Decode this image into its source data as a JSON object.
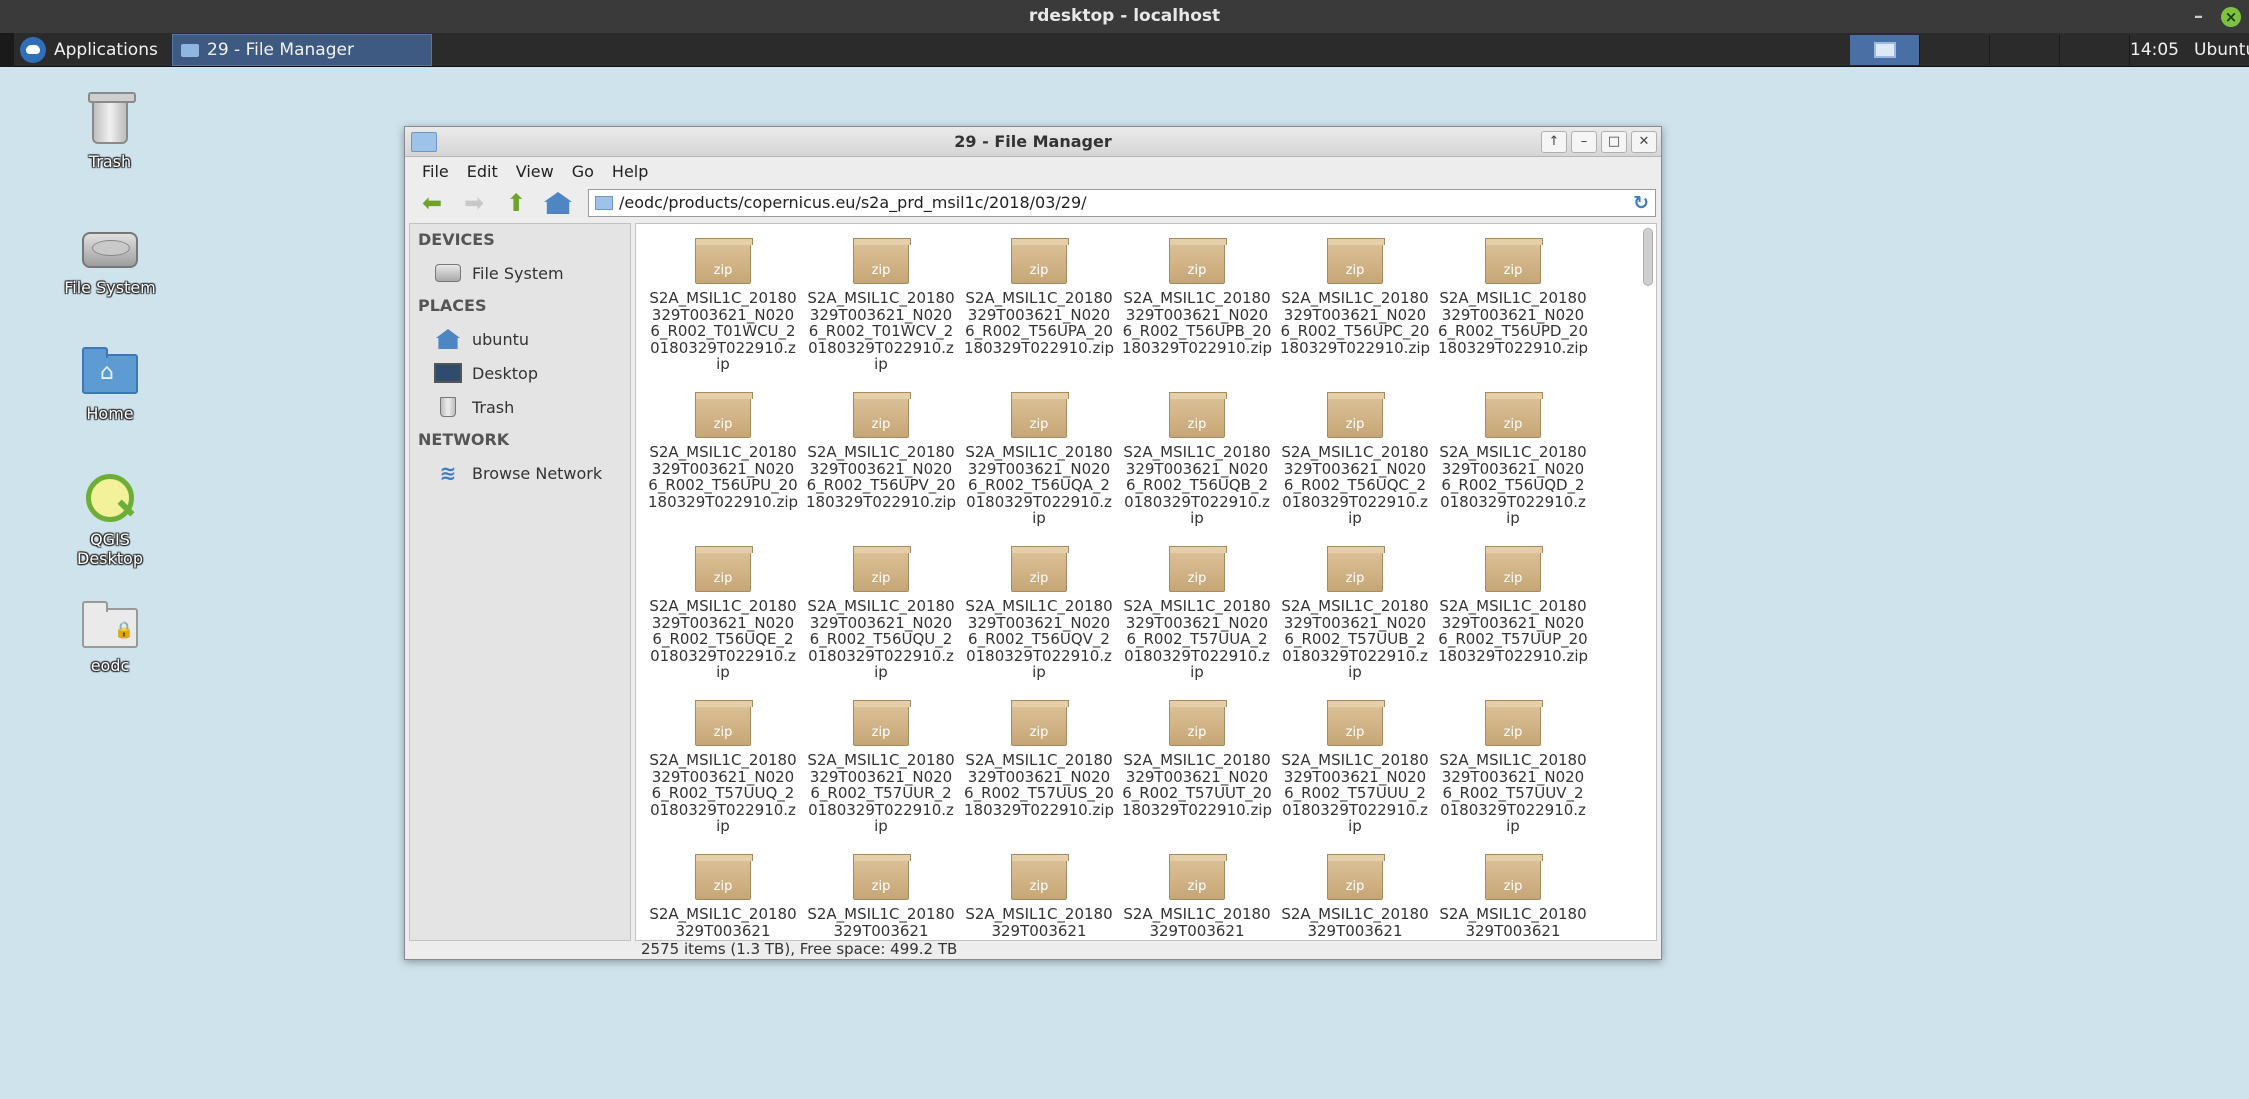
{
  "rdesktop": {
    "title": "rdesktop - localhost",
    "minimize": "–",
    "close": "×"
  },
  "panel": {
    "applications_label": "Applications",
    "task_label": "29 - File Manager",
    "clock": "14:05",
    "user": "Ubuntu"
  },
  "desktop_icons": [
    {
      "label": "Trash",
      "icon": "trash-icon"
    },
    {
      "label": "File System",
      "icon": "drive-icon"
    },
    {
      "label": "Home",
      "icon": "home-folder-icon"
    },
    {
      "label": "QGIS Desktop",
      "icon": "qgis-icon"
    },
    {
      "label": "eodc",
      "icon": "locked-folder-icon"
    }
  ],
  "file_manager": {
    "title": "29 - File Manager",
    "menu": [
      "File",
      "Edit",
      "View",
      "Go",
      "Help"
    ],
    "address": "/eodc/products/copernicus.eu/s2a_prd_msil1c/2018/03/29/",
    "sidebar": {
      "devices_header": "DEVICES",
      "devices": [
        "File System"
      ],
      "places_header": "PLACES",
      "places": [
        "ubuntu",
        "Desktop",
        "Trash"
      ],
      "network_header": "NETWORK",
      "network": [
        "Browse Network"
      ]
    },
    "files": [
      "S2A_MSIL1C_20180329T003621_N0206_R002_T01WCU_20180329T022910.zip",
      "S2A_MSIL1C_20180329T003621_N0206_R002_T01WCV_20180329T022910.zip",
      "S2A_MSIL1C_20180329T003621_N0206_R002_T56UPA_20180329T022910.zip",
      "S2A_MSIL1C_20180329T003621_N0206_R002_T56UPB_20180329T022910.zip",
      "S2A_MSIL1C_20180329T003621_N0206_R002_T56UPC_20180329T022910.zip",
      "S2A_MSIL1C_20180329T003621_N0206_R002_T56UPD_20180329T022910.zip",
      "S2A_MSIL1C_20180329T003621_N0206_R002_T56UPU_20180329T022910.zip",
      "S2A_MSIL1C_20180329T003621_N0206_R002_T56UPV_20180329T022910.zip",
      "S2A_MSIL1C_20180329T003621_N0206_R002_T56UQA_20180329T022910.zip",
      "S2A_MSIL1C_20180329T003621_N0206_R002_T56UQB_20180329T022910.zip",
      "S2A_MSIL1C_20180329T003621_N0206_R002_T56UQC_20180329T022910.zip",
      "S2A_MSIL1C_20180329T003621_N0206_R002_T56UQD_20180329T022910.zip",
      "S2A_MSIL1C_20180329T003621_N0206_R002_T56UQE_20180329T022910.zip",
      "S2A_MSIL1C_20180329T003621_N0206_R002_T56UQU_20180329T022910.zip",
      "S2A_MSIL1C_20180329T003621_N0206_R002_T56UQV_20180329T022910.zip",
      "S2A_MSIL1C_20180329T003621_N0206_R002_T57UUA_20180329T022910.zip",
      "S2A_MSIL1C_20180329T003621_N0206_R002_T57UUB_20180329T022910.zip",
      "S2A_MSIL1C_20180329T003621_N0206_R002_T57UUP_20180329T022910.zip",
      "S2A_MSIL1C_20180329T003621_N0206_R002_T57UUQ_20180329T022910.zip",
      "S2A_MSIL1C_20180329T003621_N0206_R002_T57UUR_20180329T022910.zip",
      "S2A_MSIL1C_20180329T003621_N0206_R002_T57UUS_20180329T022910.zip",
      "S2A_MSIL1C_20180329T003621_N0206_R002_T57UUT_20180329T022910.zip",
      "S2A_MSIL1C_20180329T003621_N0206_R002_T57UUU_20180329T022910.zip",
      "S2A_MSIL1C_20180329T003621_N0206_R002_T57UUV_20180329T022910.zip",
      "S2A_MSIL1C_20180329T003621",
      "S2A_MSIL1C_20180329T003621",
      "S2A_MSIL1C_20180329T003621",
      "S2A_MSIL1C_20180329T003621",
      "S2A_MSIL1C_20180329T003621",
      "S2A_MSIL1C_20180329T003621"
    ],
    "zip_badge": "zip",
    "status": "2575 items (1.3 TB), Free space: 499.2 TB"
  }
}
